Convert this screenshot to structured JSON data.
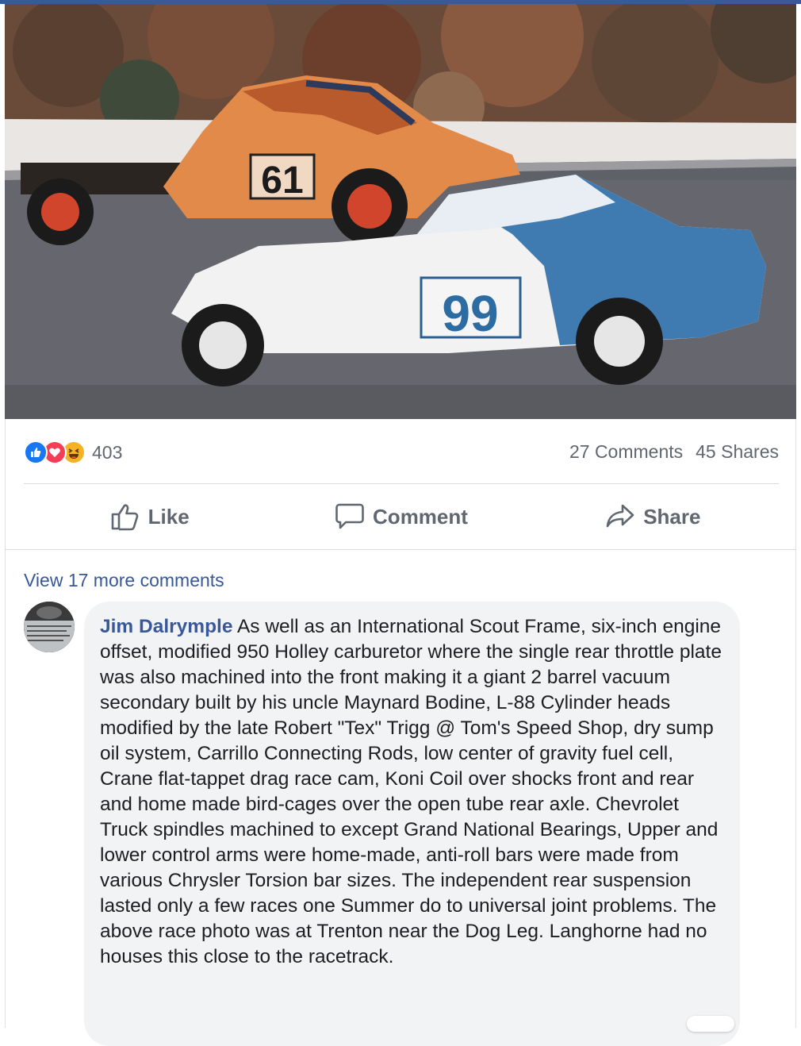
{
  "post": {
    "photo_alt_icon": "race-photo-image",
    "reaction_icons": [
      "like-reaction-icon",
      "love-reaction-icon",
      "haha-reaction-icon"
    ],
    "reaction_count": "403",
    "comments_count": "27 Comments",
    "shares_count": "45 Shares",
    "car_numbers": [
      "61",
      "99"
    ]
  },
  "actions": {
    "like_label": "Like",
    "comment_label": "Comment",
    "share_label": "Share"
  },
  "comments": {
    "view_more_label": "View 17 more comments",
    "items": [
      {
        "author": "Jim Dalrymple",
        "text": "As well as an International Scout Frame, six-inch engine offset, modified 950 Holley carburetor where the single rear throttle plate was also machined into the front making it a giant 2 barrel vacuum secondary built by his uncle Maynard Bodine, L-88 Cylinder heads modified by the late Robert \"Tex\" Trigg @ Tom's Speed Shop, dry sump oil system, Carrillo Connecting Rods, low center of gravity fuel cell, Crane flat-tappet drag race cam, Koni Coil over shocks front and rear and home made bird-cages over the open tube rear axle. Chevrolet Truck spindles machined to except Grand National Bearings, Upper and lower control arms were home-made, anti-roll bars were made from various Chrysler Torsion bar sizes. The independent rear suspension lasted only a few races one Summer do to universal joint problems. The above race photo was at Trenton near the Dog Leg. Langhorne had no houses this close to the racetrack."
      }
    ]
  },
  "colors": {
    "brand": "#3b5998",
    "link": "#385898",
    "muted": "#606770",
    "like": "#1877f2",
    "love": "#f33e58",
    "haha": "#f7b125"
  }
}
